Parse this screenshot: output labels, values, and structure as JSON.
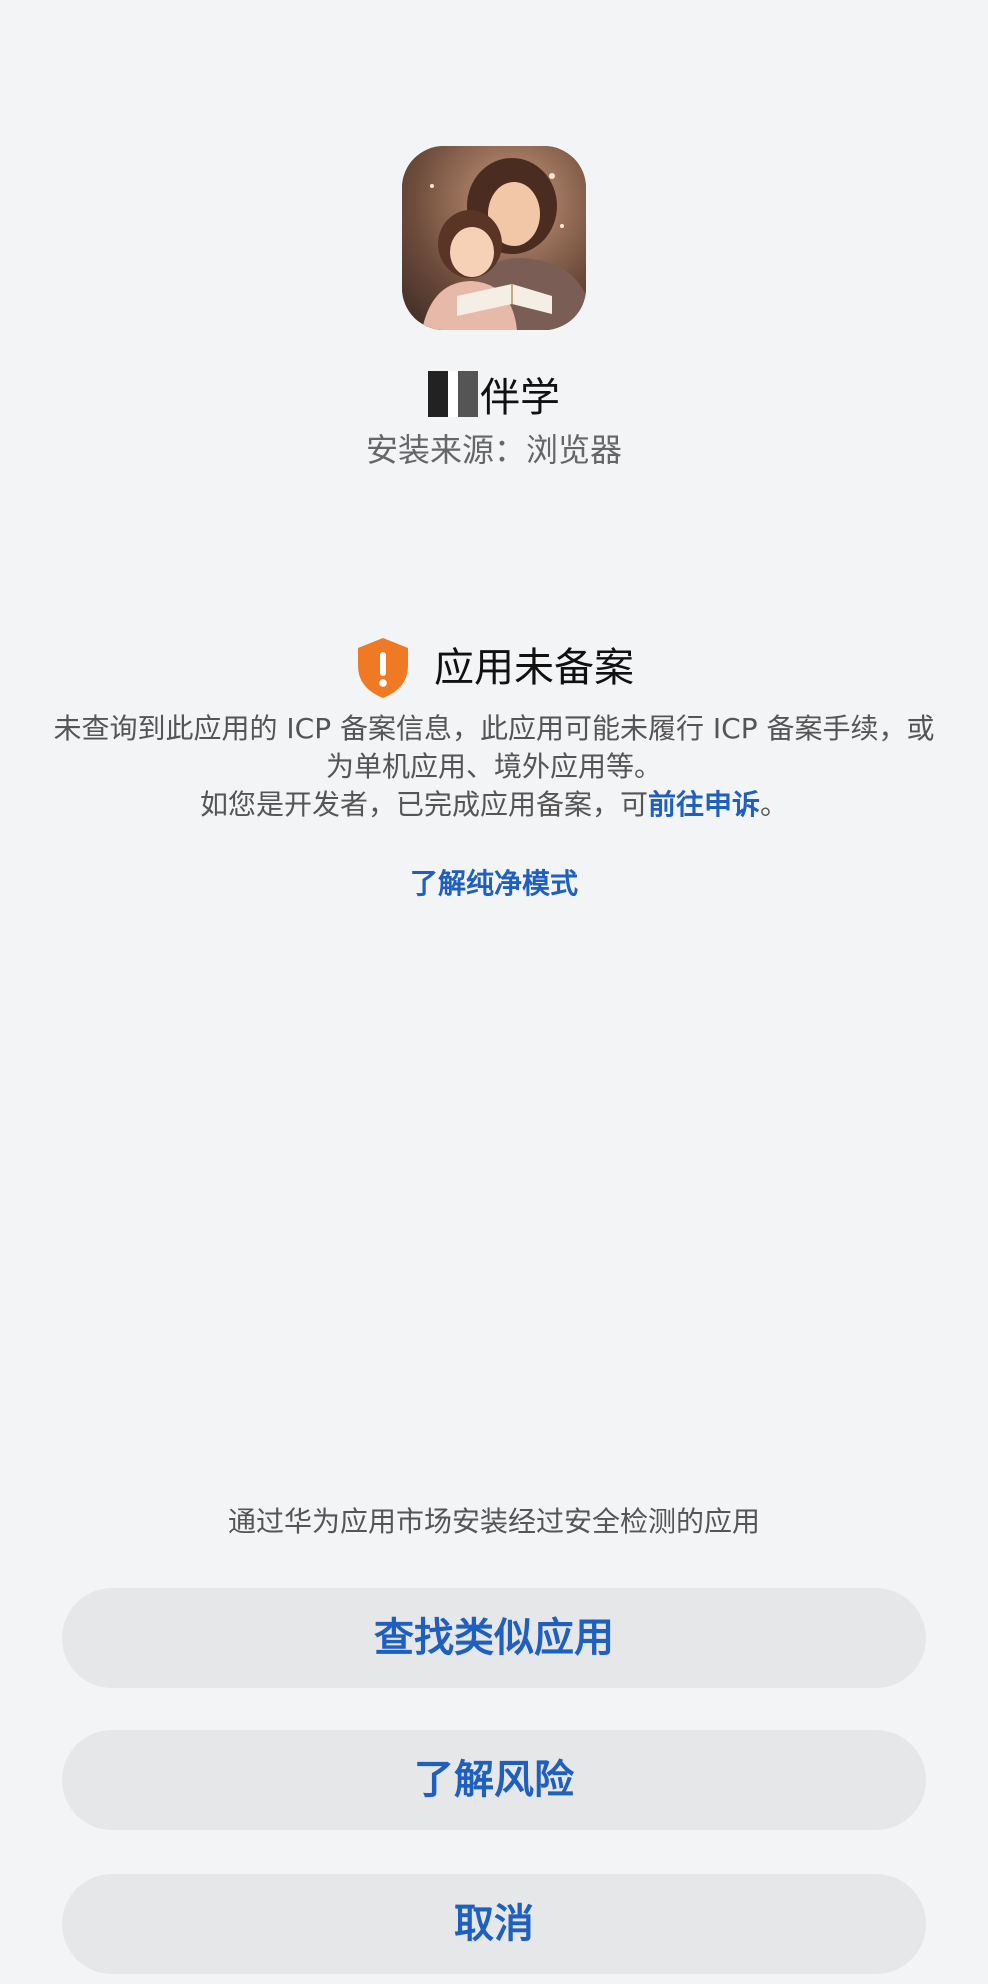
{
  "app": {
    "name_visible": "伴学",
    "install_source": "安装来源：浏览器"
  },
  "warning": {
    "title": "应用未备案",
    "line1": "未查询到此应用的 ICP 备案信息，此应用可能未履行 ICP 备案手续，或为单机应用、境外应用等。",
    "line2_prefix": "如您是开发者，已完成应用备案，可",
    "appeal_link": "前往申诉",
    "line2_suffix": "。",
    "learn_link": "了解纯净模式",
    "icon": "shield-exclamation-icon",
    "icon_color": "#f07a23"
  },
  "footer": {
    "hint": "通过华为应用市场安装经过安全检测的应用",
    "buttons": {
      "find_similar": "查找类似应用",
      "learn_risk": "了解风险",
      "cancel": "取消"
    }
  },
  "colors": {
    "accent": "#1f5fbf",
    "background": "#f3f4f6",
    "button_bg": "#e6e7e9"
  }
}
